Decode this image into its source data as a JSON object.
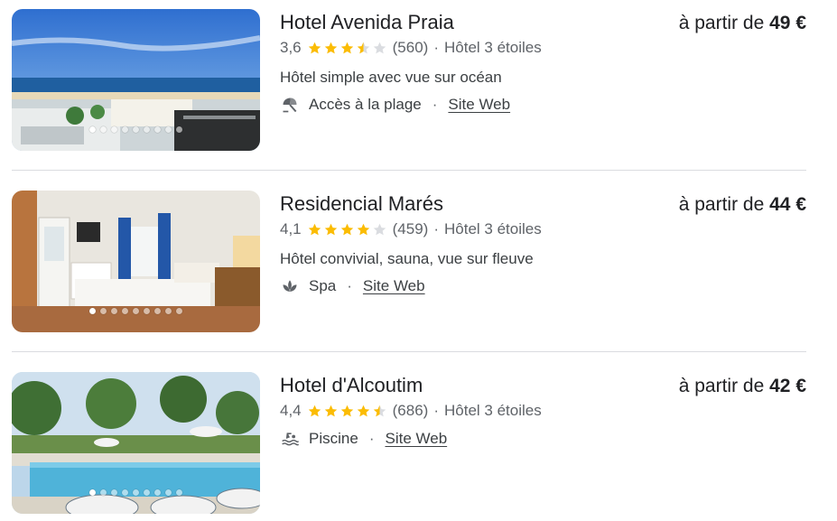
{
  "hotels": [
    {
      "name": "Hotel Avenida Praia",
      "rating": "3,6",
      "rating_value": 3.6,
      "reviews": "(560)",
      "class_label": "Hôtel 3 étoiles",
      "description": "Hôtel simple avec vue sur océan",
      "amenity": {
        "icon": "beach-umbrella-icon",
        "label": "Accès à la plage"
      },
      "website_label": "Site Web",
      "price_prefix": "à partir de",
      "price": "49 €",
      "photo_count": 9,
      "active_photo": 0
    },
    {
      "name": "Residencial Marés",
      "rating": "4,1",
      "rating_value": 4.1,
      "reviews": "(459)",
      "class_label": "Hôtel 3 étoiles",
      "description": "Hôtel convivial, sauna, vue sur fleuve",
      "amenity": {
        "icon": "spa-lotus-icon",
        "label": "Spa"
      },
      "website_label": "Site Web",
      "price_prefix": "à partir de",
      "price": "44 €",
      "photo_count": 9,
      "active_photo": 0
    },
    {
      "name": "Hotel d'Alcoutim",
      "rating": "4,4",
      "rating_value": 4.4,
      "reviews": "(686)",
      "class_label": "Hôtel 3 étoiles",
      "description": "",
      "amenity": {
        "icon": "pool-icon",
        "label": "Piscine"
      },
      "website_label": "Site Web",
      "price_prefix": "à partir de",
      "price": "42 €",
      "photo_count": 9,
      "active_photo": 0
    }
  ],
  "colors": {
    "star": "#fbbc04",
    "star_empty": "#dadce0",
    "text": "#202124",
    "muted": "#5f6368",
    "divider": "#dadce0"
  }
}
